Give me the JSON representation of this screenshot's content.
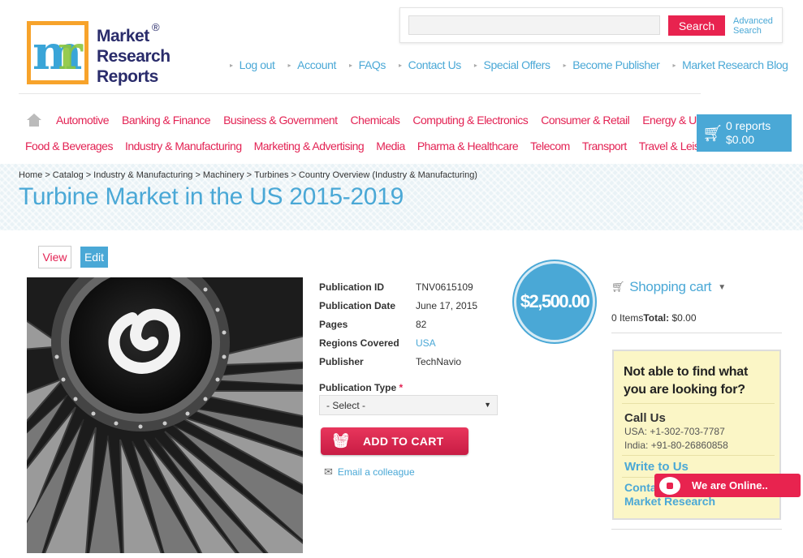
{
  "logo": {
    "line1": "Market",
    "line2": "Research",
    "line3": "Reports",
    "reg": "®"
  },
  "search": {
    "button": "Search",
    "advanced_line1": "Advanced",
    "advanced_line2": "Search",
    "placeholder": ""
  },
  "top_links": [
    "Log out",
    "Account",
    "FAQs",
    "Contact Us",
    "Special Offers",
    "Become Publisher",
    "Market Research Blog"
  ],
  "categories_row1": [
    "Automotive",
    "Banking & Finance",
    "Business & Government",
    "Chemicals",
    "Computing & Electronics",
    "Consumer & Retail",
    "Energy & Utilities"
  ],
  "categories_row2": [
    "Food & Beverages",
    "Industry & Manufacturing",
    "Marketing & Advertising",
    "Media",
    "Pharma & Healthcare",
    "Telecom",
    "Transport",
    "Travel & Leisure"
  ],
  "cart": {
    "count": "0 reports",
    "total": "$0.00"
  },
  "breadcrumb": [
    "Home",
    "Catalog",
    "Industry & Manufacturing",
    "Machinery",
    "Turbines",
    "Country Overview (Industry & Manufacturing)"
  ],
  "page_title": "Turbine Market in the US 2015-2019",
  "tabs": {
    "view": "View",
    "edit": "Edit"
  },
  "details": [
    {
      "label": "Publication ID",
      "value": "TNV0615109"
    },
    {
      "label": "Publication Date",
      "value": "June 17, 2015"
    },
    {
      "label": "Pages",
      "value": "82"
    },
    {
      "label": "Regions Covered",
      "value": "USA"
    },
    {
      "label": "Publisher",
      "value": "TechNavio"
    }
  ],
  "price": "$2,500.00",
  "publication_type": {
    "label": "Publication Type",
    "required_mark": "*",
    "selected": "- Select -"
  },
  "add_to_cart": "ADD TO CART",
  "email_colleague": "Email a colleague",
  "shopping_cart": {
    "title": "Shopping cart",
    "items": "0 Items",
    "total_label": "Total:",
    "total_value": "$0.00"
  },
  "help": {
    "title_line1": "Not able to find what",
    "title_line2": "you are looking for?",
    "call_us": "Call Us",
    "phone_usa": "USA: +1-302-703-7787",
    "phone_india": "India: +91-80-26860858",
    "write_to_us": "Write to Us",
    "contact_line1": "Contact",
    "contact_line2": "Market Research"
  },
  "chat": {
    "label": "We are Online.."
  },
  "colors": {
    "accent_blue": "#4aa8d6",
    "accent_red": "#e32354",
    "logo_orange": "#f7a32b",
    "logo_navy": "#2a2c6b"
  }
}
